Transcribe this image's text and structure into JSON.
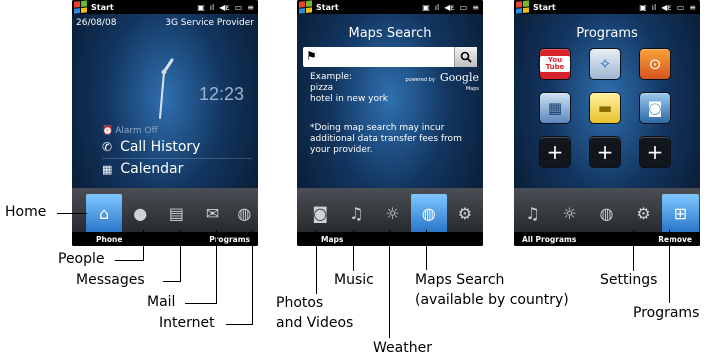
{
  "phone1": {
    "status_title": "Start",
    "date": "26/08/08",
    "provider": "3G Service Provider",
    "time": "12:23",
    "alarm": "Alarm Off",
    "call_history": "Call History",
    "calendar": "Calendar",
    "softkey_left": "Phone",
    "softkey_right": "Programs"
  },
  "phone2": {
    "status_title": "Start",
    "header": "Maps Search",
    "example_title": "Example:",
    "example_line1": "pizza",
    "example_line2": "hotel in new york",
    "powered_by": "powered by",
    "google": "Google",
    "maps_small": "Maps",
    "disclaimer": "*Doing map search may incur additional data transfer fees from your provider.",
    "softkey_left": "Maps",
    "softkey_right": ""
  },
  "phone3": {
    "status_title": "Start",
    "header": "Programs",
    "youtube_text": "You Tube",
    "softkey_left": "All Programs",
    "softkey_right": "Remove"
  },
  "callouts": {
    "home": "Home",
    "people": "People",
    "messages": "Messages",
    "mail": "Mail",
    "internet": "Internet",
    "photos": "Photos",
    "and_videos": "and Videos",
    "music": "Music",
    "maps_search": "Maps Search",
    "available": "(available by country)",
    "weather": "Weather",
    "settings": "Settings",
    "programs": "Programs"
  },
  "colors": {
    "tab_selected": "#3d8fe0",
    "screen_dark": "#0b1d33"
  }
}
